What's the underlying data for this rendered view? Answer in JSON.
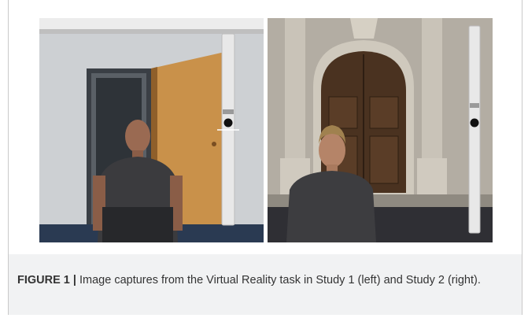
{
  "figure": {
    "label": "FIGURE 1 |",
    "caption_text": " Image captures from the Virtual Reality task in Study 1 (left) and Study 2 (right)."
  },
  "panels": [
    {
      "scene": "room-doorway-with-avatar-and-rating-slider",
      "slider_level": 0.5
    },
    {
      "scene": "building-entrance-with-avatar-and-rating-slider",
      "slider_level": 0.5
    }
  ],
  "colors": {
    "caption_band": "#f1f2f3",
    "caption_text": "#333333",
    "frame_border": "#c9c9c9"
  }
}
